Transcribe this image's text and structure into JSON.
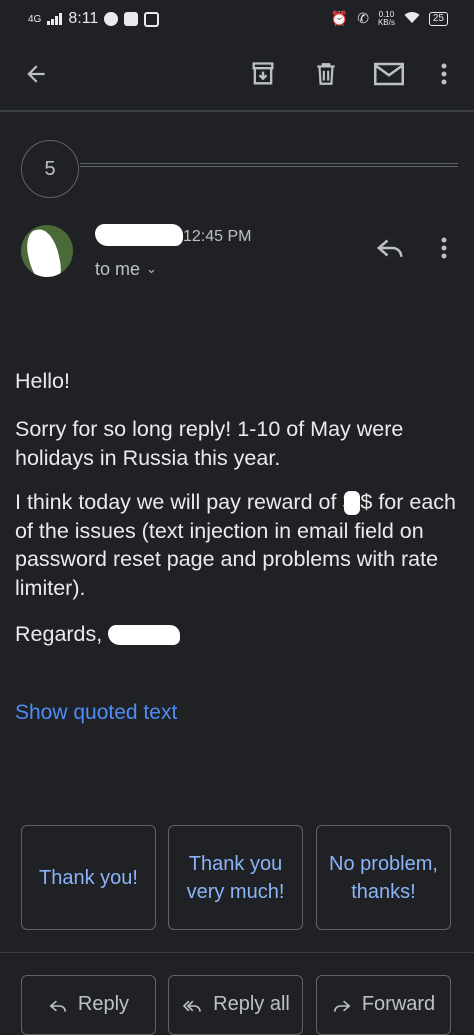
{
  "status_bar": {
    "network": "4G",
    "time": "8:11",
    "speed_value": "0.10",
    "speed_unit": "KB/s",
    "battery": "25"
  },
  "toolbar": {
    "icons": [
      "back-arrow-icon",
      "archive-icon",
      "delete-icon",
      "mail-icon",
      "more-vert-icon"
    ]
  },
  "thread": {
    "collapsed_count": "5"
  },
  "message": {
    "time": "12:45 PM",
    "recipient": "to me",
    "greeting": "Hello!",
    "para1": "Sorry for so long reply! 1-10 of May were holidays in Russia this year.",
    "para2_before": "I think today we will pay reward of 3",
    "para2_after": "$ for each of the issues (text injection in email field on password reset page and problems with rate limiter).",
    "signoff": "Regards,",
    "show_quoted": "Show quoted text"
  },
  "smart_replies": [
    "Thank you!",
    "Thank you very much!",
    "No problem, thanks!"
  ],
  "actions": {
    "reply": "Reply",
    "reply_all": "Reply all",
    "forward": "Forward"
  },
  "colors": {
    "background": "#202124",
    "link": "#4c8df6",
    "chip_text": "#8ab4f8",
    "text": "#e8eaed"
  }
}
